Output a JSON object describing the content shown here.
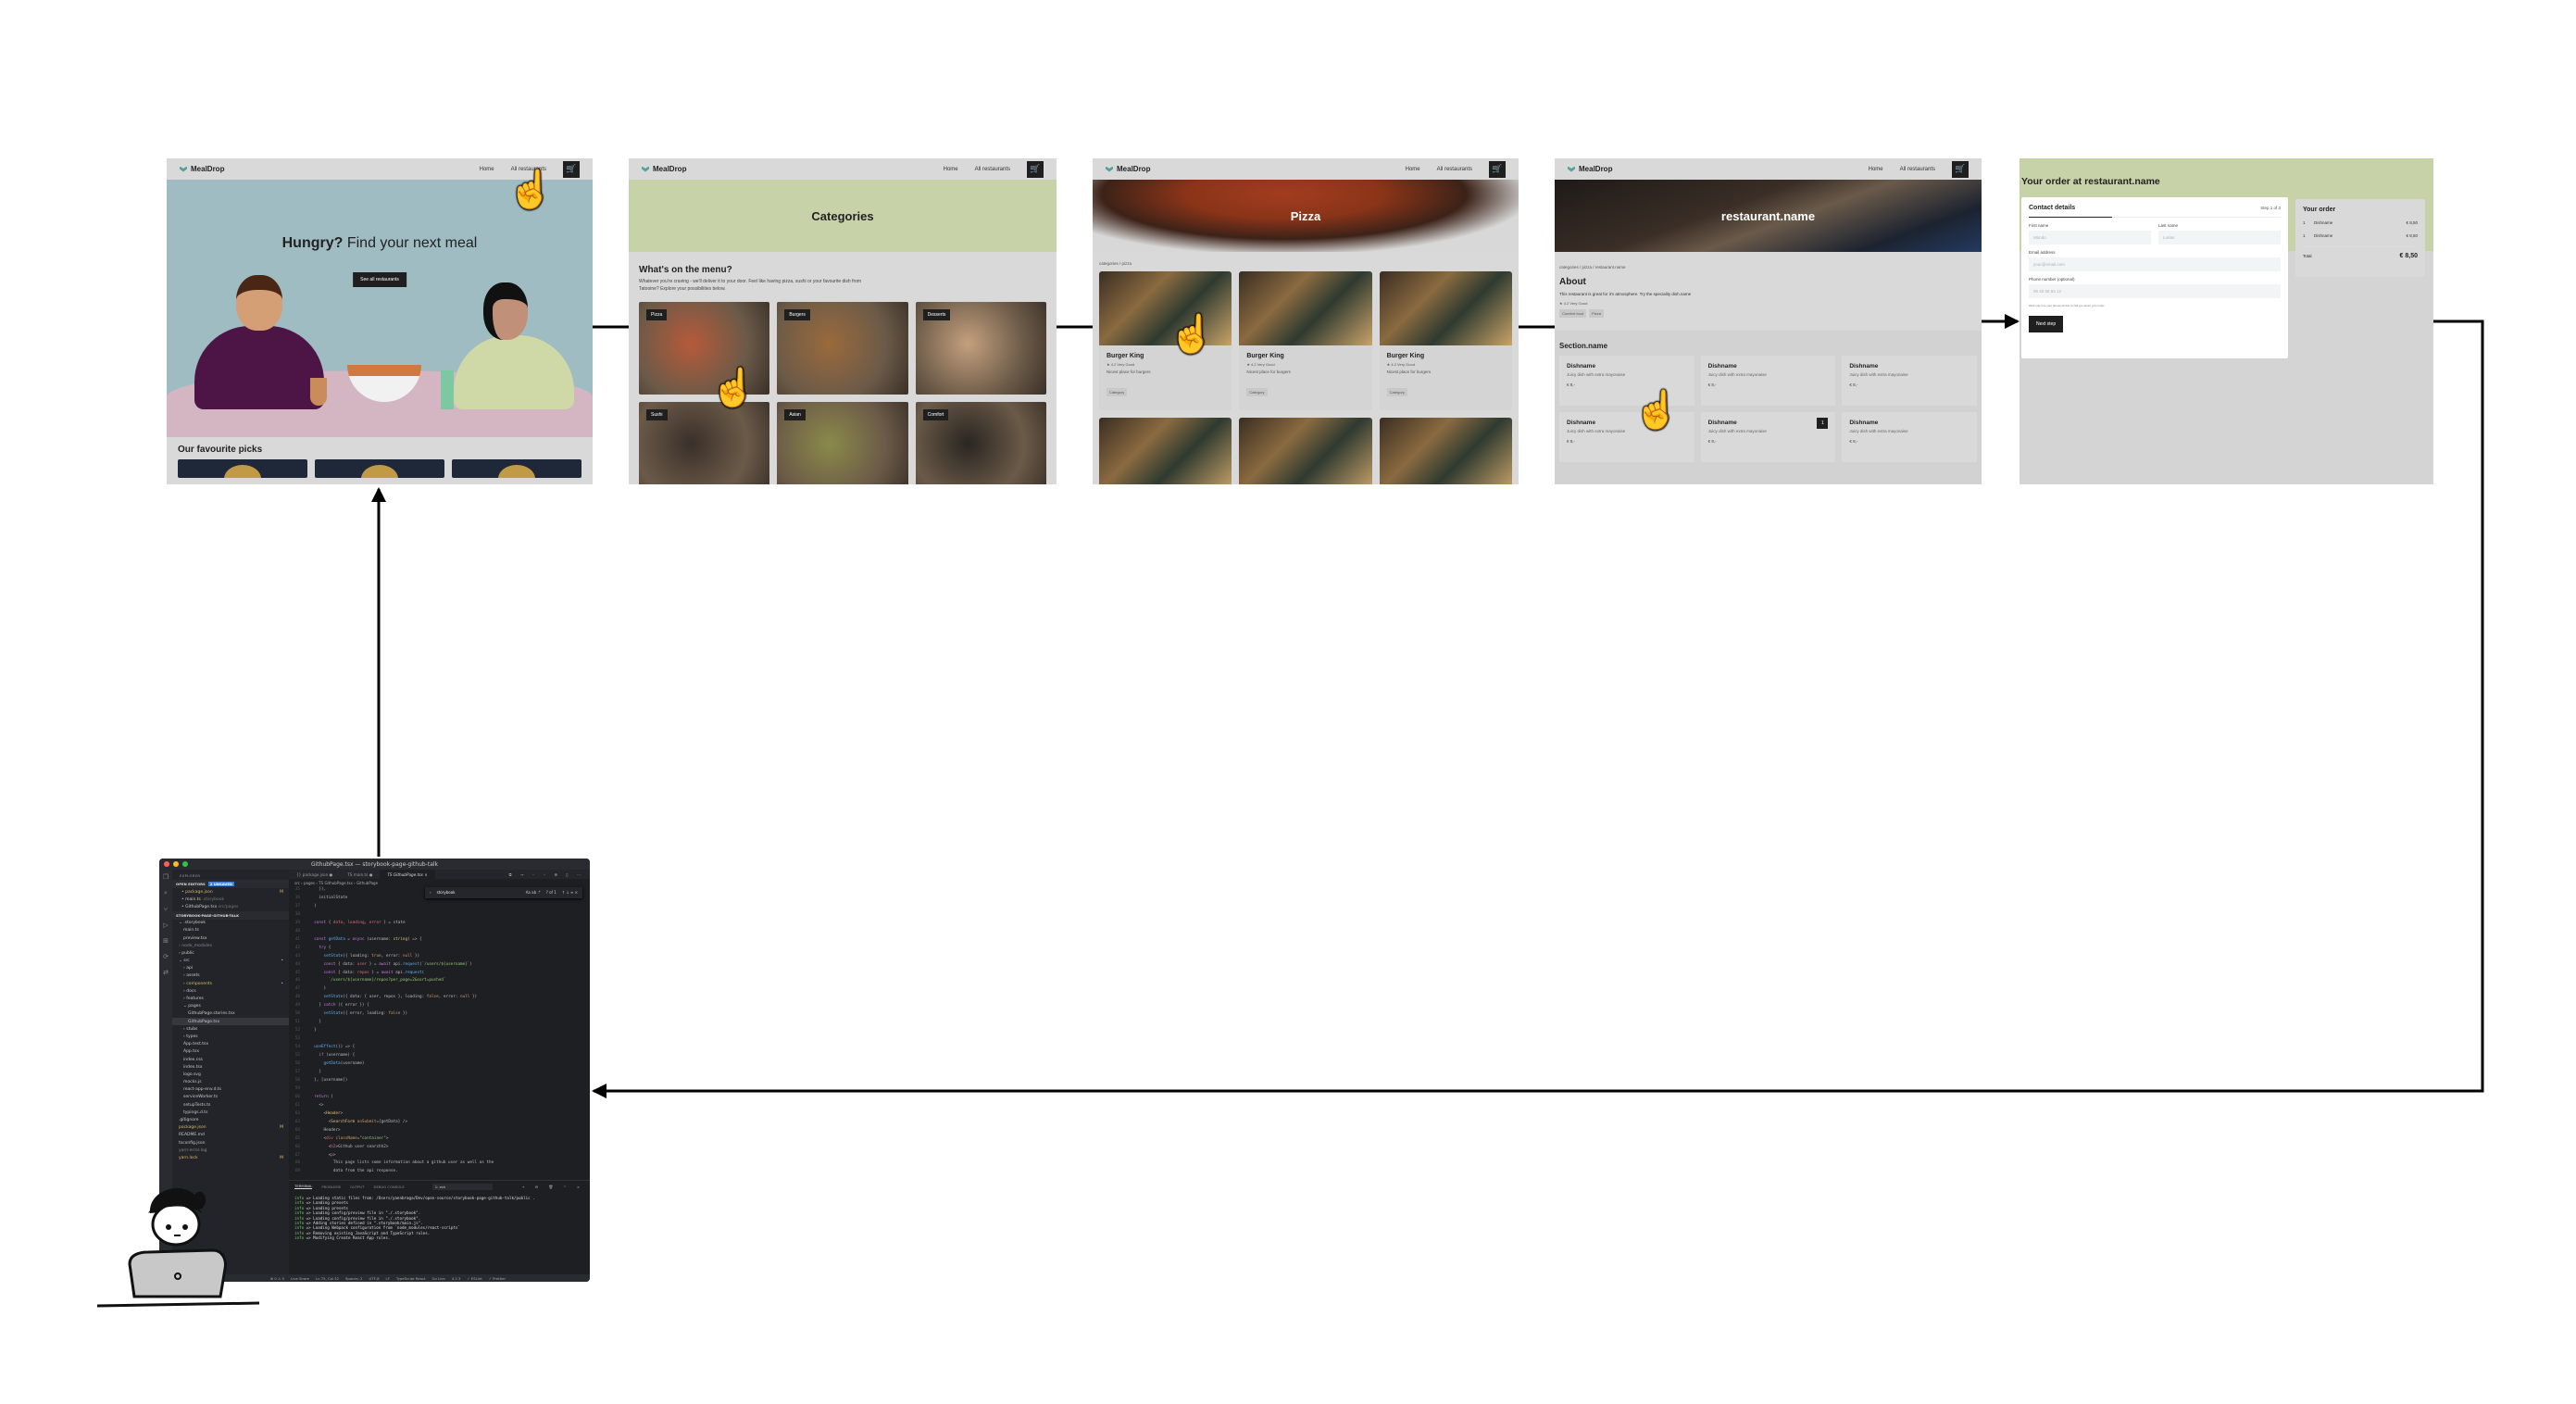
{
  "diagram": {
    "type": "user-flow",
    "description_nodes": [
      "home",
      "categories",
      "category-pizza",
      "restaurant-detail",
      "checkout",
      "code-editor"
    ],
    "edges": [
      {
        "from": "home",
        "to": "categories"
      },
      {
        "from": "categories",
        "to": "category-pizza"
      },
      {
        "from": "category-pizza",
        "to": "restaurant-detail"
      },
      {
        "from": "restaurant-detail",
        "to": "checkout"
      },
      {
        "from": "checkout",
        "to": "code-editor"
      },
      {
        "from": "code-editor",
        "to": "home"
      }
    ]
  },
  "brand": {
    "name": "MealDrop",
    "accent": "#4fa3a1",
    "dark": "#1f1f1f",
    "green_band": "#c8d2a8",
    "blue_band": "#9fbcc3"
  },
  "nav": {
    "home": "Home",
    "all_restaurants": "All restaurants",
    "cart_icon": "🛒"
  },
  "home": {
    "title_bold": "Hungry?",
    "title_rest": " Find your next meal",
    "cta": "See all restaurants",
    "favourites_heading": "Our favourite picks"
  },
  "categories": {
    "banner_title": "Categories",
    "heading": "What's on the menu?",
    "intro": "Whatever you're craving - we'll deliver it to your door. Feel like having pizza, sushi or your favourite dish from Tatooine? Explore your possibilities below.",
    "tiles": [
      {
        "label": "Pizza",
        "color": "#b65a3a"
      },
      {
        "label": "Burgers",
        "color": "#9a6a3c"
      },
      {
        "label": "Desserts",
        "color": "#c4a07e"
      },
      {
        "label": "Sushi",
        "color": "#3a302a"
      },
      {
        "label": "Asian",
        "color": "#8a8a4a"
      },
      {
        "label": "Comfort",
        "color": "#2a2622"
      }
    ]
  },
  "category_page": {
    "banner_title": "Pizza",
    "breadcrumb": "categories / pizza",
    "restaurants": [
      {
        "name": "Burger King",
        "rating": "4.2",
        "rating_label": "Very Good",
        "description": "Nicest place for burgers",
        "tag": "Category"
      },
      {
        "name": "Burger King",
        "rating": "4.2",
        "rating_label": "Very Good",
        "description": "Nicest place for burgers",
        "tag": "Category"
      },
      {
        "name": "Burger King",
        "rating": "4.2",
        "rating_label": "Very Good",
        "description": "Nicest place for burgers",
        "tag": "Category"
      }
    ]
  },
  "restaurant_page": {
    "banner_title": "restaurant.name",
    "breadcrumb": "categories / pizza / restaurant.name",
    "about_heading": "About",
    "about_text": "This restaurant is great for it's atmosphere. Try the speciality dish.name",
    "rating": "4.2",
    "rating_label": "Very Good",
    "tags": [
      "Comfort food",
      "Pizza"
    ],
    "section_heading": "Section.name",
    "dishes": [
      {
        "name": "Dishname",
        "description": "Juicy dish with extra mayonaise",
        "price": "€ 8,-",
        "qty": ""
      },
      {
        "name": "Dishname",
        "description": "Juicy dish with extra mayonaise",
        "price": "€ 8,-",
        "qty": ""
      },
      {
        "name": "Dishname",
        "description": "Juicy dish with extra mayonaise",
        "price": "€ 8,-",
        "qty": ""
      },
      {
        "name": "Dishname",
        "description": "Juicy dish with extra mayonaise",
        "price": "€ 8,-",
        "qty": ""
      },
      {
        "name": "Dishname",
        "description": "Juicy dish with extra mayonaise",
        "price": "€ 8,-",
        "qty": "1"
      },
      {
        "name": "Dishname",
        "description": "Juicy dish with extra mayonaise",
        "price": "€ 8,-",
        "qty": ""
      }
    ]
  },
  "checkout": {
    "title": "Your order at restaurant.name",
    "contact_heading": "Contact details",
    "step": "Step 1 of 3",
    "first_name_label": "First name",
    "first_name_placeholder": "Mando",
    "last_name_label": "Last name",
    "last_name_placeholder": "Lorian",
    "email_label": "Email address",
    "email_placeholder": "your@email.com",
    "phone_label": "Phone number (optional)",
    "phone_placeholder": "06 40 56 84 12",
    "phone_hint": "We'll only use your phonenumber to call you about your order",
    "next_button": "Next step",
    "summary_heading": "Your order",
    "items": [
      {
        "qty": "1",
        "name": "Dishname",
        "price": "€ 8,50"
      },
      {
        "qty": "1",
        "name": "Dishname",
        "price": "€ 8,50"
      }
    ],
    "total_label": "Total",
    "total_value": "€ 8,50"
  },
  "vscode": {
    "window_title": "GithubPage.tsx — storybook-page-github-talk",
    "explorer_label": "EXPLORER",
    "open_editors_label": "OPEN EDITORS",
    "unsaved_badge": "2 UNSAVED",
    "open_editors": [
      {
        "name": "package.json",
        "hint": "",
        "marker": "M",
        "mod": true
      },
      {
        "name": "main.ts",
        "hint": ".storybook",
        "marker": "",
        "mod": false
      },
      {
        "name": "GithubPage.tsx",
        "hint": "src/pages",
        "marker": "",
        "mod": false
      }
    ],
    "project_label": "STORYBOOK-PAGE-GITHUB-TALK",
    "tree": [
      {
        "name": "⌄ .storybook",
        "indent": 1,
        "cls": ""
      },
      {
        "name": "main.ts",
        "indent": 2,
        "cls": ""
      },
      {
        "name": "preview.tsx",
        "indent": 2,
        "cls": ""
      },
      {
        "name": "› node_modules",
        "indent": 1,
        "cls": "dim"
      },
      {
        "name": "› public",
        "indent": 1,
        "cls": ""
      },
      {
        "name": "⌄ src",
        "indent": 1,
        "cls": "",
        "marker": "•"
      },
      {
        "name": "› api",
        "indent": 2,
        "cls": ""
      },
      {
        "name": "› assets",
        "indent": 2,
        "cls": ""
      },
      {
        "name": "› components",
        "indent": 2,
        "cls": "mod",
        "marker": "•"
      },
      {
        "name": "› docs",
        "indent": 2,
        "cls": ""
      },
      {
        "name": "› features",
        "indent": 2,
        "cls": ""
      },
      {
        "name": "⌄ pages",
        "indent": 2,
        "cls": ""
      },
      {
        "name": "GithubPage.stories.tsx",
        "indent": 3,
        "cls": ""
      },
      {
        "name": "GithubPage.tsx",
        "indent": 3,
        "cls": "sel"
      },
      {
        "name": "› stubs",
        "indent": 2,
        "cls": ""
      },
      {
        "name": "› types",
        "indent": 2,
        "cls": ""
      },
      {
        "name": "App.test.tsx",
        "indent": 2,
        "cls": ""
      },
      {
        "name": "App.tsx",
        "indent": 2,
        "cls": ""
      },
      {
        "name": "index.css",
        "indent": 2,
        "cls": ""
      },
      {
        "name": "index.tsx",
        "indent": 2,
        "cls": ""
      },
      {
        "name": "logo.svg",
        "indent": 2,
        "cls": ""
      },
      {
        "name": "mocks.js",
        "indent": 2,
        "cls": ""
      },
      {
        "name": "react-app-env.d.ts",
        "indent": 2,
        "cls": ""
      },
      {
        "name": "serviceWorker.ts",
        "indent": 2,
        "cls": ""
      },
      {
        "name": "setupTests.ts",
        "indent": 2,
        "cls": ""
      },
      {
        "name": "typings.d.ts",
        "indent": 2,
        "cls": ""
      },
      {
        "name": ".gitignore",
        "indent": 1,
        "cls": ""
      },
      {
        "name": "package.json",
        "indent": 1,
        "cls": "mod",
        "marker": "M"
      },
      {
        "name": "README.md",
        "indent": 1,
        "cls": ""
      },
      {
        "name": "tsconfig.json",
        "indent": 1,
        "cls": ""
      },
      {
        "name": "yarn-error.log",
        "indent": 1,
        "cls": "dim"
      },
      {
        "name": "yarn.lock",
        "indent": 1,
        "cls": "mod",
        "marker": "M"
      }
    ],
    "tabs": [
      {
        "label": "{} package.json ●",
        "active": false
      },
      {
        "label": "TS main.ts ●",
        "active": false
      },
      {
        "label": "TS GithubPage.tsx ×",
        "active": true
      }
    ],
    "breadcrumb": "src › pages › TS GithubPage.tsx › GithubPage",
    "find_query": "storybook",
    "find_result": "? of 1",
    "code_lines": [
      {
        "n": "35",
        "html": "    }),"
      },
      {
        "n": "36",
        "html": "    initialState"
      },
      {
        "n": "37",
        "html": "  )"
      },
      {
        "n": "38",
        "html": ""
      },
      {
        "n": "39",
        "html": "  <span class='kw'>const</span> { <span class='vr'>data</span>, <span class='vr'>loading</span>, <span class='vr'>error</span> } = state"
      },
      {
        "n": "40",
        "html": ""
      },
      {
        "n": "41",
        "html": "  <span class='kw'>const</span> <span class='fn'>getData</span> = <span class='kw'>async</span> (username: <span class='tg'>string</span>) => {"
      },
      {
        "n": "42",
        "html": "    <span class='kw'>try</span> {"
      },
      {
        "n": "43",
        "html": "      <span class='fn'>setState</span>({ loading: <span class='nm'>true</span>, error: <span class='nm'>null</span> })"
      },
      {
        "n": "44",
        "html": "      <span class='kw'>const</span> { data: <span class='vr'>user</span> } = <span class='kw'>await</span> api.<span class='fn'>request</span>(<span class='st'>`/users/${username}`</span>)"
      },
      {
        "n": "45",
        "html": "      <span class='kw'>const</span> { data: <span class='vr'>repos</span> } = <span class='kw'>await</span> api.<span class='fn'>request</span>("
      },
      {
        "n": "46",
        "html": "        <span class='st'>`/users/${username}/repos?per_page=2&sort=pushed`</span>"
      },
      {
        "n": "47",
        "html": "      )"
      },
      {
        "n": "48",
        "html": "      <span class='fn'>setState</span>({ data: { user, repos }, loading: <span class='nm'>false</span>, error: <span class='nm'>null</span> })"
      },
      {
        "n": "49",
        "html": "    } <span class='kw'>catch</span> ({ error }) {"
      },
      {
        "n": "50",
        "html": "      <span class='fn'>setState</span>({ error, loading: <span class='nm'>false</span> })"
      },
      {
        "n": "51",
        "html": "    }"
      },
      {
        "n": "52",
        "html": "  }"
      },
      {
        "n": "53",
        "html": ""
      },
      {
        "n": "54",
        "html": "  <span class='fn'>useEffect</span>(() => {"
      },
      {
        "n": "55",
        "html": "    <span class='kw'>if</span> (username) {"
      },
      {
        "n": "56",
        "html": "      <span class='fn'>getData</span>(username)"
      },
      {
        "n": "57",
        "html": "    }"
      },
      {
        "n": "58",
        "html": "  }, [username])"
      },
      {
        "n": "59",
        "html": ""
      },
      {
        "n": "60",
        "html": "  <span class='kw'>return</span> ("
      },
      {
        "n": "61",
        "html": "    <>"
      },
      {
        "n": "62",
        "html": "      <<span class='tg'>Header</span>>"
      },
      {
        "n": "63",
        "html": "        <<span class='tg'>SearchForm</span> <span class='at'>onSubmit</span>={getData} />"
      },
      {
        "n": "64",
        "html": "      </<span class='tg'>Header</span>>"
      },
      {
        "n": "65",
        "html": "      <<span class='vr'>div</span> <span class='at'>className</span>=<span class='st'>\"container\"</span>>"
      },
      {
        "n": "66",
        "html": "        <<span class='vr'>h2</span>>Github user search</<span class='vr'>h2</span>>"
      },
      {
        "n": "67",
        "html": "        <<span class='vr'>p</span>>"
      },
      {
        "n": "68",
        "html": "          This page lists some information about a github user as well as the"
      },
      {
        "n": "69",
        "html": "          data from the api response."
      }
    ],
    "terminal_tabs": [
      "TERMINAL",
      "PROBLEMS",
      "OUTPUT",
      "DEBUG CONSOLE"
    ],
    "terminal_shell": "1: zsh",
    "terminal_lines": [
      "=> Loading static files from: /Users/yannbraga/Dev/open-source/storybook-page-github-talk/public .",
      "=> Loading presets",
      "=> Loading presets",
      "=> Loading config/preview file in \"./.storybook\".",
      "=> Loading config/preview file in \"./.storybook\".",
      "=> Adding stories defined in \".storybook/main.js\".",
      "=> Loading Webpack configuration from `node_modules/react-scripts`",
      "=> Removing existing JavaScript and TypeScript rules.",
      "=> Modifying Create React App rules."
    ],
    "terminal_prefix": "info",
    "status_items": [
      "⊗ 0 ⚠ 0",
      "Live Share",
      "Ln 75, Col 32",
      "Spaces: 2",
      "UTF-8",
      "LF",
      "TypeScript React",
      "Go Live",
      "4.2.3",
      "✓ ESLint",
      "✓ Prettier"
    ]
  }
}
